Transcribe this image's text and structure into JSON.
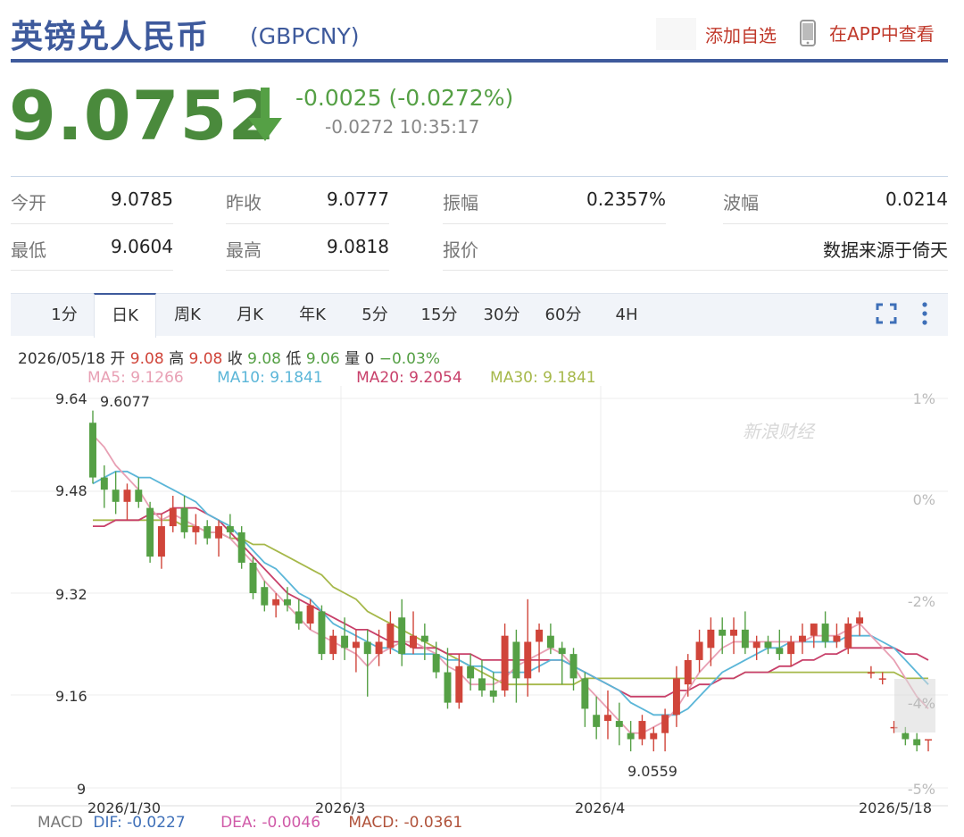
{
  "header": {
    "title_cn": "英镑兑人民币",
    "code": "(GBPCNY)",
    "add_fav": "添加自选",
    "app_view": "在APP中查看",
    "phone_icon": "phone-icon"
  },
  "price": {
    "last": "9.0752",
    "change": "-0.0025 (-0.0272%)",
    "sub": "-0.0272 10:35:17",
    "direction_icon": "down-arrow-icon",
    "color": "#4a8a3c"
  },
  "stats": {
    "open_label": "今开",
    "open": "9.0785",
    "prev_label": "昨收",
    "prev": "9.0777",
    "amp_label": "振幅",
    "amp": "0.2357%",
    "wave_label": "波幅",
    "wave": "0.0214",
    "low_label": "最低",
    "low": "9.0604",
    "high_label": "最高",
    "high": "9.0818",
    "quote_label": "报价",
    "source": "数据来源于倚天"
  },
  "tabs": [
    "1分",
    "日K",
    "周K",
    "月K",
    "年K",
    "5分",
    "15分",
    "30分",
    "60分",
    "4H"
  ],
  "active_tab": "日K",
  "ohlc": {
    "date": "2026/05/18",
    "open_label": "开",
    "open": "9.08",
    "high_label": "高",
    "high": "9.08",
    "close_label": "收",
    "close": "9.08",
    "low_label": "低",
    "low": "9.06",
    "vol_label": "量",
    "vol": "0",
    "chg": "−0.03%"
  },
  "ma": {
    "ma5": "MA5: 9.1266",
    "ma10": "MA10: 9.1841",
    "ma20": "MA20: 9.2054",
    "ma30": "MA30: 9.1841",
    "ma5_color": "#e8a0b4",
    "ma10_color": "#5bb6d8",
    "ma20_color": "#c8406a",
    "ma30_color": "#a6b84a"
  },
  "macd": {
    "label": "MACD",
    "dif": "DIF: -0.0227",
    "dea": "DEA: -0.0046",
    "macd": "MACD: -0.0361"
  },
  "watermark": "新浪财经",
  "chart_data": {
    "type": "candlestick",
    "ylim": [
      9.0,
      9.64
    ],
    "y_ticks": [
      "9.64",
      "9.48",
      "9.32",
      "9.16",
      "9"
    ],
    "pct_ticks": [
      "1%",
      "0%",
      "-2%",
      "-4%",
      "-5%"
    ],
    "x_ticks": [
      "2026/1/30",
      "2026/3",
      "2026/4",
      "2026/5/18"
    ],
    "annotations": {
      "max": "9.6077",
      "min": "9.0559"
    },
    "up_color": "#d0453a",
    "down_color": "#55a045",
    "candles": [
      [
        9.6,
        9.62,
        9.5,
        9.51
      ],
      [
        9.51,
        9.53,
        9.46,
        9.49
      ],
      [
        9.49,
        9.52,
        9.45,
        9.47
      ],
      [
        9.47,
        9.5,
        9.44,
        9.49
      ],
      [
        9.49,
        9.51,
        9.46,
        9.47
      ],
      [
        9.46,
        9.47,
        9.37,
        9.38
      ],
      [
        9.38,
        9.45,
        9.36,
        9.43
      ],
      [
        9.43,
        9.48,
        9.42,
        9.46
      ],
      [
        9.46,
        9.48,
        9.41,
        9.42
      ],
      [
        9.42,
        9.45,
        9.4,
        9.43
      ],
      [
        9.43,
        9.44,
        9.4,
        9.41
      ],
      [
        9.41,
        9.44,
        9.38,
        9.43
      ],
      [
        9.43,
        9.45,
        9.41,
        9.42
      ],
      [
        9.42,
        9.43,
        9.36,
        9.37
      ],
      [
        9.37,
        9.38,
        9.31,
        9.32
      ],
      [
        9.33,
        9.34,
        9.29,
        9.3
      ],
      [
        9.3,
        9.32,
        9.28,
        9.31
      ],
      [
        9.31,
        9.33,
        9.29,
        9.3
      ],
      [
        9.29,
        9.31,
        9.26,
        9.27
      ],
      [
        9.27,
        9.31,
        9.26,
        9.3
      ],
      [
        9.29,
        9.3,
        9.21,
        9.22
      ],
      [
        9.22,
        9.26,
        9.21,
        9.25
      ],
      [
        9.25,
        9.28,
        9.21,
        9.23
      ],
      [
        9.23,
        9.26,
        9.19,
        9.24
      ],
      [
        9.24,
        9.26,
        9.15,
        9.22
      ],
      [
        9.22,
        9.26,
        9.2,
        9.24
      ],
      [
        9.23,
        9.29,
        9.22,
        9.27
      ],
      [
        9.28,
        9.31,
        9.2,
        9.22
      ],
      [
        9.23,
        9.29,
        9.22,
        9.25
      ],
      [
        9.25,
        9.27,
        9.21,
        9.24
      ],
      [
        9.22,
        9.24,
        9.18,
        9.19
      ],
      [
        9.19,
        9.23,
        9.13,
        9.14
      ],
      [
        9.14,
        9.22,
        9.13,
        9.2
      ],
      [
        9.2,
        9.22,
        9.16,
        9.18
      ],
      [
        9.18,
        9.21,
        9.15,
        9.16
      ],
      [
        9.16,
        9.19,
        9.14,
        9.15
      ],
      [
        9.16,
        9.27,
        9.15,
        9.25
      ],
      [
        9.24,
        9.26,
        9.14,
        9.18
      ],
      [
        9.18,
        9.31,
        9.15,
        9.24
      ],
      [
        9.24,
        9.27,
        9.19,
        9.26
      ],
      [
        9.25,
        9.27,
        9.22,
        9.23
      ],
      [
        9.23,
        9.24,
        9.17,
        9.22
      ],
      [
        9.22,
        9.23,
        9.16,
        9.18
      ],
      [
        9.18,
        9.19,
        9.1,
        9.13
      ],
      [
        9.12,
        9.15,
        9.08,
        9.1
      ],
      [
        9.11,
        9.16,
        9.08,
        9.12
      ],
      [
        9.11,
        9.14,
        9.07,
        9.1
      ],
      [
        9.09,
        9.11,
        9.06,
        9.08
      ],
      [
        9.08,
        9.12,
        9.07,
        9.11
      ],
      [
        9.08,
        9.1,
        9.06,
        9.09
      ],
      [
        9.09,
        9.13,
        9.06,
        9.12
      ],
      [
        9.12,
        9.2,
        9.1,
        9.18
      ],
      [
        9.17,
        9.22,
        9.15,
        9.21
      ],
      [
        9.21,
        9.26,
        9.19,
        9.24
      ],
      [
        9.23,
        9.28,
        9.2,
        9.26
      ],
      [
        9.26,
        9.28,
        9.22,
        9.25
      ],
      [
        9.25,
        9.28,
        9.22,
        9.26
      ],
      [
        9.26,
        9.29,
        9.22,
        9.23
      ],
      [
        9.23,
        9.25,
        9.21,
        9.24
      ],
      [
        9.24,
        9.25,
        9.22,
        9.23
      ],
      [
        9.23,
        9.26,
        9.21,
        9.22
      ],
      [
        9.22,
        9.25,
        9.2,
        9.24
      ],
      [
        9.24,
        9.27,
        9.22,
        9.25
      ],
      [
        9.25,
        9.27,
        9.23,
        9.27
      ],
      [
        9.27,
        9.29,
        9.23,
        9.24
      ],
      [
        9.24,
        9.27,
        9.23,
        9.25
      ],
      [
        9.23,
        9.28,
        9.22,
        9.27
      ],
      [
        9.27,
        9.29,
        9.25,
        9.28
      ],
      [
        9.19,
        9.2,
        9.18,
        9.19
      ],
      [
        9.18,
        9.19,
        9.17,
        9.18
      ],
      [
        9.1,
        9.11,
        9.09,
        9.1
      ],
      [
        9.09,
        9.1,
        9.07,
        9.08
      ],
      [
        9.08,
        9.09,
        9.06,
        9.07
      ],
      [
        9.08,
        9.08,
        9.06,
        9.08
      ]
    ],
    "ma5": [
      9.58,
      9.56,
      9.53,
      9.51,
      9.49,
      9.46,
      9.44,
      9.45,
      9.44,
      9.43,
      9.42,
      9.42,
      9.41,
      9.39,
      9.37,
      9.34,
      9.32,
      9.3,
      9.28,
      9.26,
      9.25,
      9.24,
      9.23,
      9.22,
      9.2,
      9.22,
      9.23,
      9.24,
      9.24,
      9.23,
      9.22,
      9.2,
      9.19,
      9.17,
      9.17,
      9.17,
      9.18,
      9.2,
      9.21,
      9.22,
      9.23,
      9.22,
      9.2,
      9.17,
      9.15,
      9.13,
      9.11,
      9.09,
      9.09,
      9.1,
      9.11,
      9.13,
      9.16,
      9.19,
      9.21,
      9.23,
      9.24,
      9.24,
      9.24,
      9.24,
      9.24,
      9.24,
      9.24,
      9.25,
      9.25,
      9.25,
      9.26,
      9.27,
      9.25,
      9.23,
      9.21,
      9.18,
      9.15,
      9.13
    ],
    "ma10": [
      9.5,
      9.51,
      9.52,
      9.52,
      9.51,
      9.51,
      9.5,
      9.49,
      9.48,
      9.47,
      9.45,
      9.44,
      9.43,
      9.41,
      9.39,
      9.37,
      9.36,
      9.34,
      9.32,
      9.31,
      9.29,
      9.27,
      9.26,
      9.25,
      9.24,
      9.23,
      9.23,
      9.22,
      9.22,
      9.22,
      9.22,
      9.21,
      9.21,
      9.2,
      9.2,
      9.19,
      9.19,
      9.19,
      9.19,
      9.2,
      9.21,
      9.21,
      9.2,
      9.19,
      9.18,
      9.17,
      9.16,
      9.14,
      9.13,
      9.12,
      9.12,
      9.12,
      9.13,
      9.15,
      9.17,
      9.19,
      9.2,
      9.21,
      9.22,
      9.23,
      9.23,
      9.24,
      9.24,
      9.24,
      9.24,
      9.24,
      9.25,
      9.25,
      9.25,
      9.24,
      9.23,
      9.21,
      9.19,
      9.17
    ],
    "ma20": [
      9.43,
      9.43,
      9.44,
      9.44,
      9.44,
      9.45,
      9.45,
      9.46,
      9.46,
      9.46,
      9.45,
      9.44,
      9.42,
      9.4,
      9.38,
      9.36,
      9.34,
      9.32,
      9.31,
      9.3,
      9.29,
      9.28,
      9.27,
      9.26,
      9.26,
      9.25,
      9.24,
      9.24,
      9.23,
      9.23,
      9.23,
      9.22,
      9.22,
      9.22,
      9.21,
      9.21,
      9.21,
      9.21,
      9.21,
      9.21,
      9.21,
      9.21,
      9.2,
      9.19,
      9.18,
      9.17,
      9.16,
      9.15,
      9.15,
      9.15,
      9.15,
      9.16,
      9.16,
      9.17,
      9.17,
      9.18,
      9.18,
      9.19,
      9.19,
      9.19,
      9.2,
      9.2,
      9.21,
      9.21,
      9.22,
      9.22,
      9.23,
      9.23,
      9.23,
      9.23,
      9.23,
      9.22,
      9.22,
      9.21
    ],
    "ma30": [
      9.44,
      9.44,
      9.44,
      9.44,
      9.44,
      9.44,
      9.44,
      9.44,
      9.43,
      9.43,
      9.42,
      9.42,
      9.41,
      9.41,
      9.4,
      9.4,
      9.39,
      9.38,
      9.37,
      9.36,
      9.35,
      9.33,
      9.32,
      9.31,
      9.29,
      9.28,
      9.27,
      9.26,
      9.25,
      9.24,
      9.23,
      9.22,
      9.21,
      9.2,
      9.19,
      9.18,
      9.17,
      9.17,
      9.17,
      9.17,
      9.17,
      9.17,
      9.17,
      9.18,
      9.18,
      9.18,
      9.18,
      9.18,
      9.18,
      9.18,
      9.18,
      9.18,
      9.18,
      9.18,
      9.18,
      9.18,
      9.18,
      9.19,
      9.19,
      9.19,
      9.19,
      9.19,
      9.19,
      9.19,
      9.19,
      9.19,
      9.19,
      9.19,
      9.19,
      9.19,
      9.19,
      9.18,
      9.18,
      9.18
    ]
  }
}
